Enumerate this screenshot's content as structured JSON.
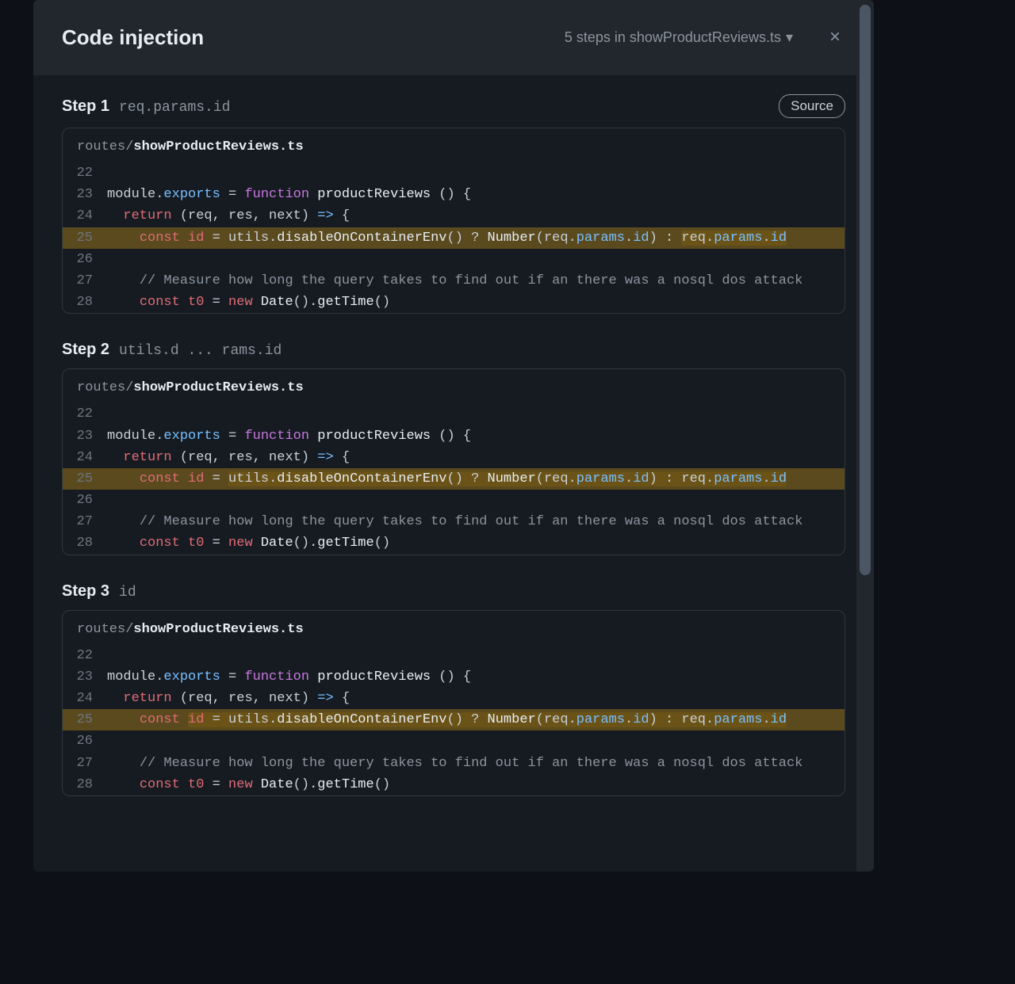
{
  "header": {
    "title": "Code injection",
    "steps_label": "5 steps in showProductReviews.ts"
  },
  "source_badge": "Source",
  "file": {
    "dir": "routes/",
    "name": "showProductReviews.ts"
  },
  "lines": {
    "n22": "22",
    "n23": "23",
    "n24": "24",
    "n25": "25",
    "n26": "26",
    "n27": "27",
    "n28": "28"
  },
  "code": {
    "l23": {
      "module": "module",
      "dot1": ".",
      "exports": "exports",
      "eq": " = ",
      "function": "function",
      "sp1": " ",
      "fn": "productReviews",
      "parens": " () {"
    },
    "l24": {
      "indent": "  ",
      "return": "return",
      "args": " (req, res, next) ",
      "arrow": "=>",
      "brace": " {"
    },
    "l25": {
      "indent": "    ",
      "const": "const",
      "sp1": " ",
      "id": "id",
      "eq": " = ",
      "utils": "utils",
      "dot1": ".",
      "disable": "disableOnContainerEnv",
      "call1": "() ? ",
      "number": "Number",
      "p1": "(",
      "req1": "req",
      "dot2": ".",
      "params1": "params",
      "dot3": ".",
      "id1": "id",
      "p2": ")",
      "colon": " : ",
      "req2": "req",
      "dot4": ".",
      "params2": "params",
      "dot5": ".",
      "id2": "id"
    },
    "l27": {
      "indent": "    ",
      "comment": "// Measure how long the query takes to find out if an there was a nosql dos attack"
    },
    "l28": {
      "indent": "    ",
      "const": "const",
      "sp1": " ",
      "t0": "t0",
      "eq": " = ",
      "new": "new",
      "sp2": " ",
      "date": "Date",
      "p1": "().",
      "gettime": "getTime",
      "p2": "()"
    }
  },
  "steps": [
    {
      "label": "Step 1",
      "expr": "req.params.id",
      "badge": true,
      "hl": "s1"
    },
    {
      "label": "Step 2",
      "expr": "utils.d ... rams.id",
      "badge": false,
      "hl": "s2"
    },
    {
      "label": "Step 3",
      "expr": "id",
      "badge": false,
      "hl": "s3"
    }
  ]
}
